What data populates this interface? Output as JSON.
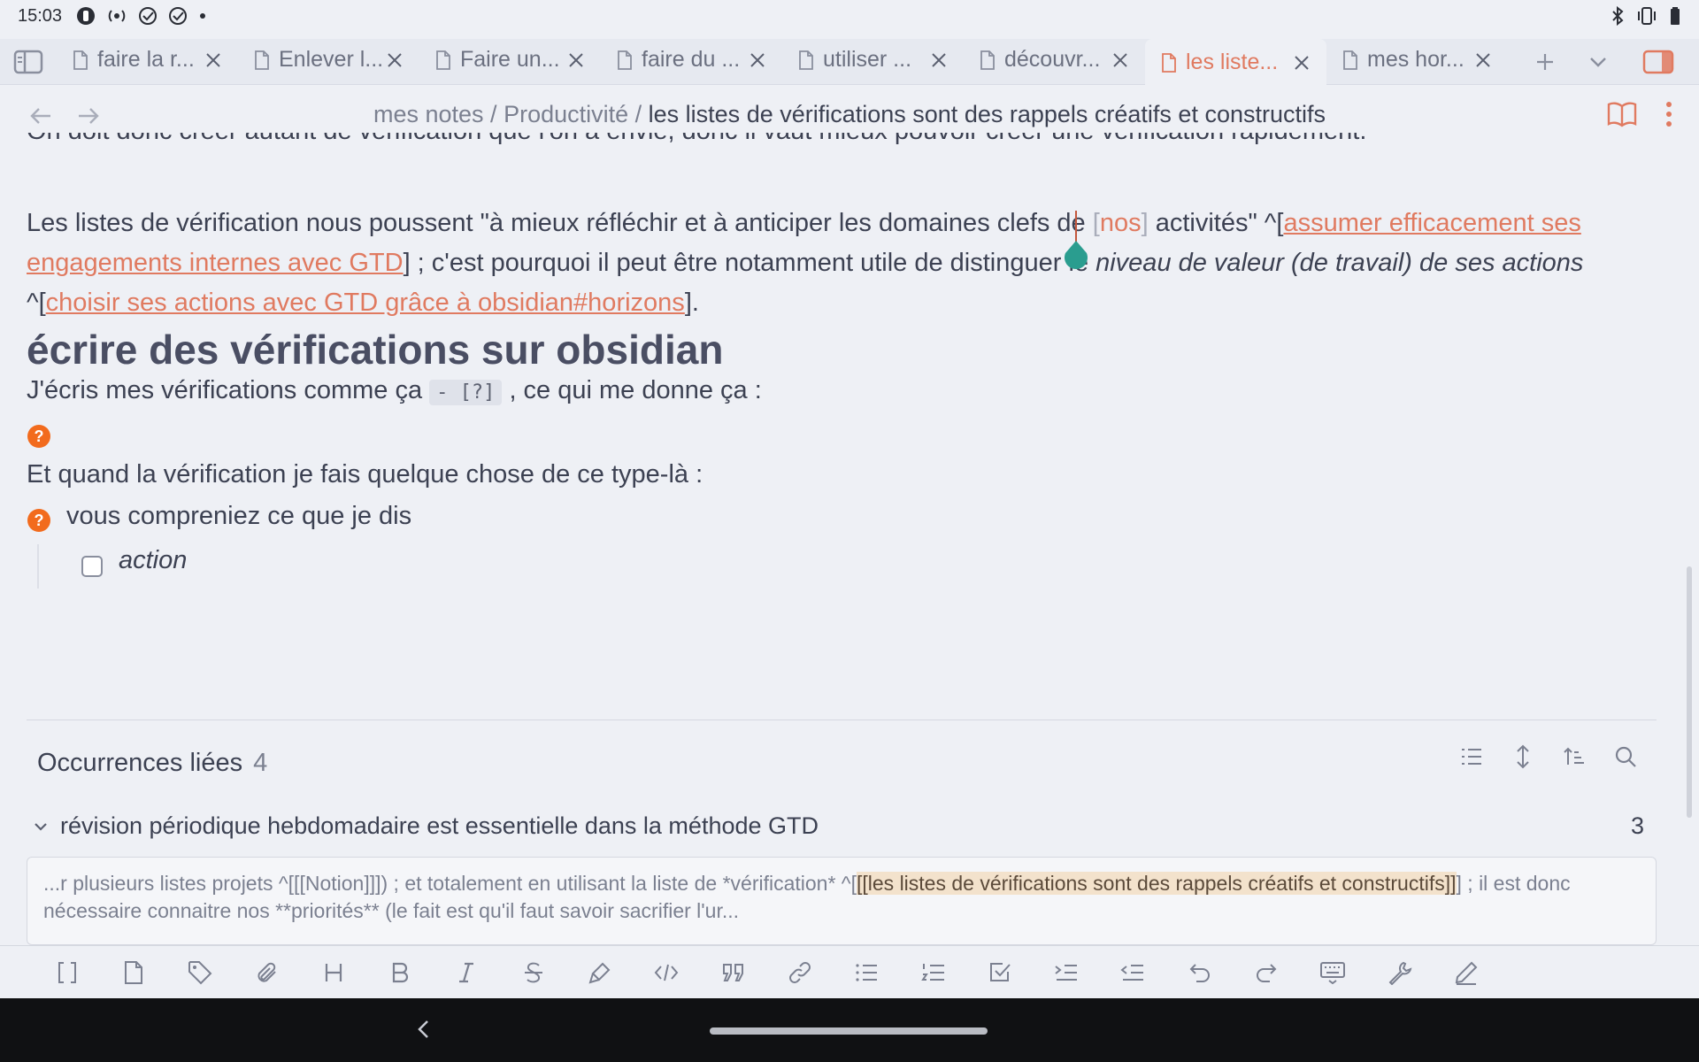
{
  "status_bar": {
    "time": "15:03",
    "left_icons": [
      "notification-icon",
      "radio-icon",
      "check-circle-icon",
      "check-circle-icon",
      "dot-icon"
    ],
    "right_icons": [
      "bluetooth-icon",
      "vibrate-icon",
      "battery-icon"
    ]
  },
  "tabs": [
    {
      "label": "faire la r...",
      "active": false
    },
    {
      "label": "Enlever l...",
      "active": false
    },
    {
      "label": "Faire un...",
      "active": false
    },
    {
      "label": "faire du ...",
      "active": false
    },
    {
      "label": "utiliser ...",
      "active": false
    },
    {
      "label": "découvr...",
      "active": false
    },
    {
      "label": "les liste...",
      "active": true
    },
    {
      "label": "mes hor...",
      "active": false
    }
  ],
  "breadcrumb": {
    "root": "mes notes",
    "sep1": " / ",
    "folder": "Productivité",
    "sep2": " / ",
    "current": "les listes de vérifications sont des rappels créatifs et constructifs"
  },
  "editor": {
    "clipped_line": "On doit donc créer autant de vérification que l'on a envie, donc il vaut mieux pouvoir créer une vérification rapidement.",
    "para_part1": "Les listes de vérification nous poussent \"à mieux réfléchir et à anticiper les domaines clefs de ",
    "bracket_open": "[",
    "nos": "nos",
    "bracket_close": "]",
    "para_part2": " activités\" ^[",
    "link1": "assumer efficacement ses engagements internes avec GTD",
    "para_part3": "] ; c'est pourquoi il peut être notamment utile de distinguer le ",
    "italic1": "niveau de valeur (de travail) de ses actions",
    "para_part4": " ^[",
    "link2": "choisir ses actions avec GTD grâce à obsidian#horizons",
    "para_part5": "].",
    "heading": "écrire des vérifications sur obsidian",
    "line1_a": "J'écris mes vérifications comme ça ",
    "line1_code": "- [?]",
    "line1_b": " , ce qui me donne ça :",
    "line2": "Et quand la vérification je fais quelque chose de ce type-là :",
    "question_item": "vous compreniez ce que je dis",
    "task_item": "action",
    "question_glyph": "?"
  },
  "backlinks": {
    "title": "Occurrences liées",
    "count": "4",
    "file_name": "révision périodique hebdomadaire est essentielle dans la méthode GTD",
    "file_count": "3",
    "snippet_pre": "...r plusieurs listes projets ^[[[Notion]]]) ; et totalement en utilisant la liste de *vérification* ^[",
    "snippet_hl": "[[les listes de vérifications sont des rappels créatifs et constructifs]]",
    "snippet_post": "] ; il est donc nécessaire connaitre nos **priorités** (le fait est qu'il faut savoir sacrifier l'ur..."
  },
  "toolbar_icons": [
    "brackets-icon",
    "file-icon",
    "tag-icon",
    "paperclip-icon",
    "heading-icon",
    "bold-icon",
    "italic-icon",
    "strikethrough-icon",
    "highlighter-icon",
    "code-icon",
    "quote-icon",
    "link-icon",
    "bullet-list-icon",
    "numbered-list-icon",
    "checkbox-icon",
    "indent-icon",
    "outdent-icon",
    "undo-icon",
    "redo-icon",
    "keyboard-icon",
    "wrench-icon",
    "pen-icon"
  ],
  "colors": {
    "accent": "#e07a60",
    "background": "#eef0f5",
    "question_orange": "#f26b1d",
    "highlight": "#f3e2cc"
  }
}
